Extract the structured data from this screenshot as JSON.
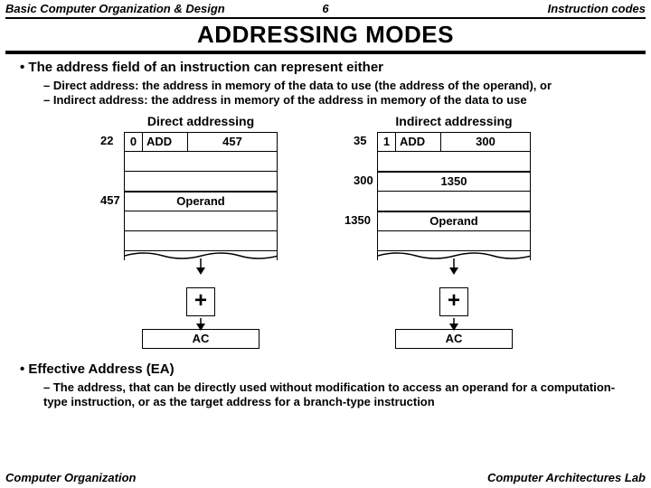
{
  "header": {
    "left": "Basic Computer Organization & Design",
    "center": "6",
    "right": "Instruction codes"
  },
  "title": "ADDRESSING MODES",
  "bullet1": "The address field of an instruction can represent either",
  "sub1a": "Direct address: the address in memory of the data to use (the address of the operand), or",
  "sub1b": "Indirect address: the address in memory of the address in memory of the data to use",
  "diagrams": {
    "direct": {
      "title": "Direct addressing",
      "instr_addr": "22",
      "flag": "0",
      "op": "ADD",
      "addr_field": "457",
      "operand_addr": "457",
      "operand_label": "Operand",
      "plus": "+",
      "ac": "AC"
    },
    "indirect": {
      "title": "Indirect addressing",
      "instr_addr": "35",
      "flag": "1",
      "op": "ADD",
      "addr_field": "300",
      "ptr_addr": "300",
      "ptr_value": "1350",
      "operand_addr": "1350",
      "operand_label": "Operand",
      "plus": "+",
      "ac": "AC"
    }
  },
  "bullet2": "Effective Address (EA)",
  "sub2": "The address, that can be directly used without modification to access an operand for a computation-type instruction, or as the target address for a branch-type instruction",
  "footer": {
    "left": "Computer Organization",
    "right": "Computer Architectures Lab"
  }
}
